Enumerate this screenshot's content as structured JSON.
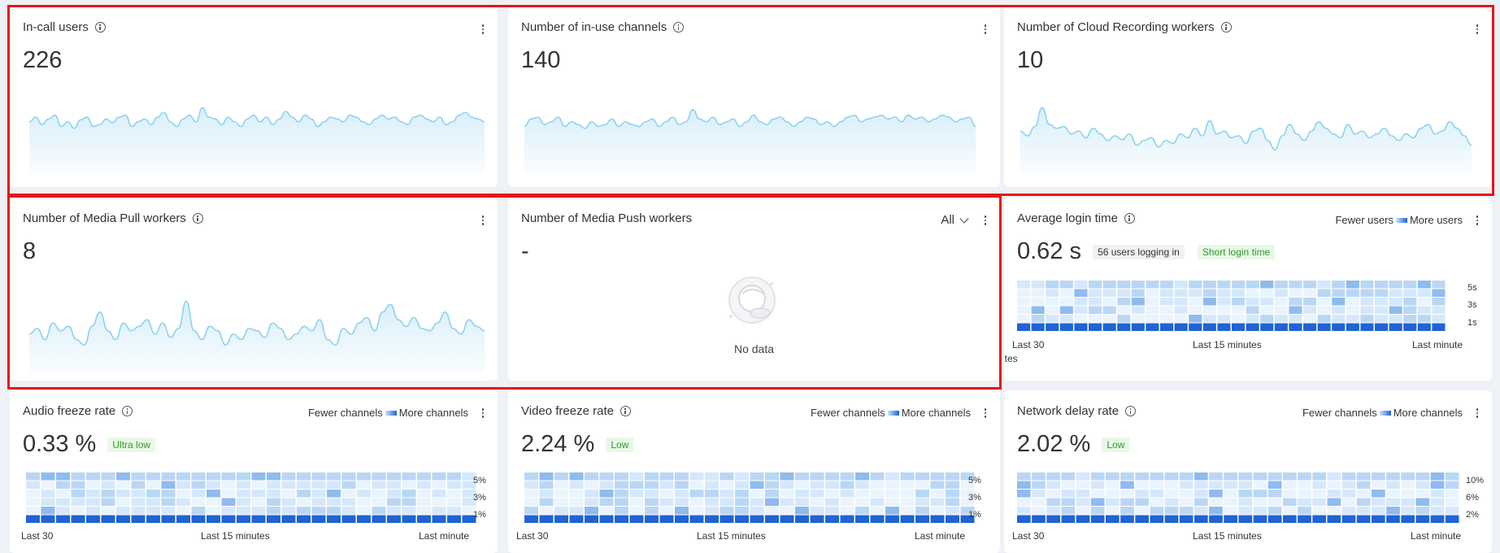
{
  "cards": {
    "in_call_users": {
      "title": "In-call users",
      "value": "226",
      "spark": [
        0.55,
        0.6,
        0.52,
        0.58,
        0.62,
        0.5,
        0.55,
        0.48,
        0.57,
        0.6,
        0.5,
        0.52,
        0.58,
        0.54,
        0.6,
        0.62,
        0.5,
        0.55,
        0.58,
        0.52,
        0.6,
        0.65,
        0.55,
        0.5,
        0.58,
        0.62,
        0.55,
        0.7,
        0.6,
        0.58,
        0.52,
        0.6,
        0.55,
        0.5,
        0.58,
        0.62,
        0.55,
        0.6,
        0.52,
        0.58,
        0.66,
        0.6,
        0.55,
        0.62,
        0.58,
        0.5,
        0.55,
        0.6,
        0.58,
        0.55,
        0.62,
        0.6,
        0.55,
        0.52,
        0.58,
        0.62,
        0.58,
        0.6,
        0.55,
        0.52,
        0.6,
        0.62,
        0.58,
        0.55,
        0.6,
        0.52,
        0.55,
        0.62,
        0.65,
        0.6,
        0.58,
        0.55
      ]
    },
    "in_use_channels": {
      "title": "Number of in-use channels",
      "value": "140",
      "spark": [
        0.5,
        0.58,
        0.6,
        0.52,
        0.55,
        0.6,
        0.5,
        0.55,
        0.52,
        0.48,
        0.55,
        0.5,
        0.52,
        0.58,
        0.5,
        0.55,
        0.52,
        0.5,
        0.55,
        0.58,
        0.5,
        0.55,
        0.6,
        0.52,
        0.55,
        0.68,
        0.58,
        0.55,
        0.6,
        0.52,
        0.55,
        0.58,
        0.5,
        0.55,
        0.62,
        0.55,
        0.52,
        0.58,
        0.6,
        0.55,
        0.5,
        0.55,
        0.6,
        0.58,
        0.52,
        0.55,
        0.5,
        0.55,
        0.6,
        0.62,
        0.55,
        0.58,
        0.6,
        0.62,
        0.58,
        0.6,
        0.55,
        0.62,
        0.58,
        0.6,
        0.55,
        0.58,
        0.62,
        0.6,
        0.55,
        0.58,
        0.6,
        0.5
      ]
    },
    "cloud_recording": {
      "title": "Number of Cloud Recording workers",
      "value": "10",
      "spark": [
        0.45,
        0.4,
        0.5,
        0.7,
        0.52,
        0.48,
        0.5,
        0.42,
        0.45,
        0.38,
        0.48,
        0.42,
        0.35,
        0.4,
        0.36,
        0.42,
        0.3,
        0.35,
        0.38,
        0.28,
        0.35,
        0.32,
        0.42,
        0.38,
        0.48,
        0.4,
        0.56,
        0.42,
        0.45,
        0.38,
        0.4,
        0.32,
        0.45,
        0.48,
        0.35,
        0.25,
        0.4,
        0.52,
        0.42,
        0.35,
        0.45,
        0.55,
        0.48,
        0.42,
        0.38,
        0.52,
        0.42,
        0.45,
        0.38,
        0.42,
        0.48,
        0.4,
        0.35,
        0.42,
        0.38,
        0.48,
        0.52,
        0.42,
        0.45,
        0.55,
        0.48,
        0.4,
        0.3
      ]
    },
    "media_pull": {
      "title": "Number of Media Pull workers",
      "value": "8",
      "spark": [
        0.35,
        0.4,
        0.3,
        0.45,
        0.38,
        0.42,
        0.3,
        0.25,
        0.42,
        0.55,
        0.38,
        0.3,
        0.45,
        0.38,
        0.42,
        0.48,
        0.35,
        0.45,
        0.32,
        0.4,
        0.65,
        0.38,
        0.3,
        0.42,
        0.38,
        0.25,
        0.35,
        0.3,
        0.4,
        0.38,
        0.32,
        0.45,
        0.4,
        0.3,
        0.35,
        0.42,
        0.38,
        0.48,
        0.3,
        0.25,
        0.4,
        0.35,
        0.45,
        0.5,
        0.38,
        0.55,
        0.62,
        0.48,
        0.42,
        0.5,
        0.4,
        0.38,
        0.45,
        0.55,
        0.4,
        0.35,
        0.48,
        0.42,
        0.38
      ]
    },
    "media_push": {
      "title": "Number of Media Push workers",
      "value": "-",
      "filter": "All",
      "empty_text": "No data"
    },
    "login_time": {
      "title": "Average login time",
      "value": "0.62 s",
      "badge1": "56 users logging in",
      "badge2": "Short login time",
      "legend_left": "Fewer users",
      "legend_right": "More users",
      "y_labels": [
        "5s",
        "3s",
        "1s"
      ],
      "x_left": "Last 30",
      "x_left2": "utes",
      "x_mid": "Last 15 minutes",
      "x_right": "Last minute"
    },
    "audio_freeze": {
      "title": "Audio freeze rate",
      "value": "0.33 %",
      "badge": "Ultra low",
      "legend_left": "Fewer channels",
      "legend_right": "More channels",
      "y_labels": [
        "5%",
        "3%",
        "1%"
      ],
      "x_left": "Last 30",
      "x_mid": "Last 15 minutes",
      "x_right": "Last minute"
    },
    "video_freeze": {
      "title": "Video freeze rate",
      "value": "2.24 %",
      "badge": "Low",
      "legend_left": "Fewer channels",
      "legend_right": "More channels",
      "y_labels": [
        "5%",
        "3%",
        "1%"
      ],
      "x_left": "Last 30",
      "x_mid": "Last 15 minutes",
      "x_right": "Last minute"
    },
    "network_delay": {
      "title": "Network delay rate",
      "value": "2.02 %",
      "badge": "Low",
      "legend_left": "Fewer channels",
      "legend_right": "More channels",
      "y_labels": [
        "10%",
        "6%",
        "2%"
      ],
      "x_left": "Last 30",
      "x_mid": "Last 15 minutes",
      "x_right": "Last minute"
    }
  },
  "colors": {
    "spark_stroke": "#8fd3ef",
    "spark_fill_top": "#d8eefa",
    "heat_levels": [
      "#eaf4fd",
      "#d5e8fb",
      "#b9d7f5",
      "#8fbbef",
      "#1f63d4"
    ],
    "highlight_border": "#e8141a"
  }
}
